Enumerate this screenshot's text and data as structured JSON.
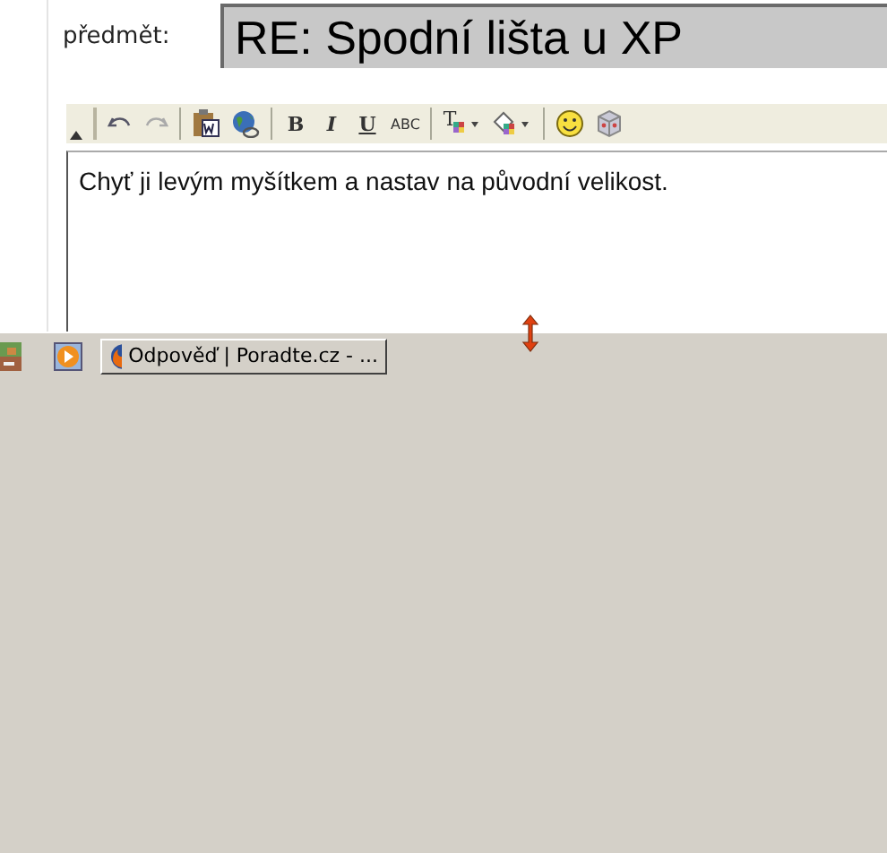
{
  "subject": {
    "label": "předmět:",
    "value": "RE: Spodní lišta u XP"
  },
  "toolbar": [
    {
      "kind": "collapse"
    },
    {
      "kind": "grip"
    },
    {
      "kind": "undo"
    },
    {
      "kind": "redo"
    },
    {
      "kind": "separator"
    },
    {
      "kind": "paste-word"
    },
    {
      "kind": "globe"
    },
    {
      "kind": "separator"
    },
    {
      "kind": "text",
      "label": "B"
    },
    {
      "kind": "text",
      "label": "I"
    },
    {
      "kind": "text",
      "label": "U"
    },
    {
      "kind": "text",
      "label": "ABC"
    },
    {
      "kind": "separator"
    },
    {
      "kind": "text-color",
      "label": "T"
    },
    {
      "kind": "fill-color"
    },
    {
      "kind": "separator"
    },
    {
      "kind": "smiley"
    },
    {
      "kind": "cube"
    }
  ],
  "editor": {
    "text": "Chyť ji levým myšítkem a nastav na původní velikost."
  },
  "taskbar": {
    "quick_launch": [
      {
        "kind": "image"
      },
      {
        "kind": "play"
      }
    ],
    "tasks": [
      {
        "label": "Odpověď | Poradte.cz - ..."
      }
    ]
  }
}
